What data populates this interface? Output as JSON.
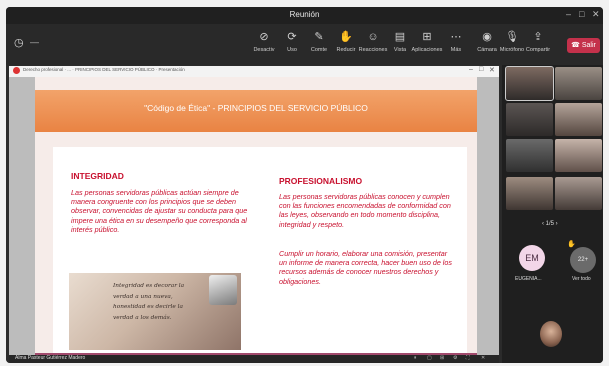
{
  "window": {
    "title": "Reunión",
    "minimize": "–",
    "maximize": "□",
    "close": "✕"
  },
  "toolbar": {
    "clock": "—",
    "tools": [
      {
        "icon": "⊘",
        "label": "Desactiv",
        "name": "camera-toggle"
      },
      {
        "icon": "⟳",
        "label": "Uso",
        "name": "mic-toggle"
      },
      {
        "icon": "✎",
        "label": "Comte",
        "name": "share-toggle"
      },
      {
        "icon": "✋",
        "label": "Reducir",
        "name": "raise-hand"
      },
      {
        "icon": "☺",
        "label": "Reacciones",
        "name": "reactions"
      },
      {
        "icon": "▤",
        "label": "Vista",
        "name": "view"
      },
      {
        "icon": "⊞",
        "label": "Aplicaciones",
        "name": "apps"
      },
      {
        "icon": "⋯",
        "label": "Más",
        "name": "more"
      },
      {
        "icon": "◉",
        "label": "Cámara",
        "name": "camera"
      },
      {
        "icon": "🎙",
        "label": "Micrófono",
        "name": "microphone"
      },
      {
        "icon": "⇪",
        "label": "Compartir",
        "name": "share"
      }
    ],
    "leave_label": "Salir"
  },
  "browser": {
    "url": "Derecho profesional · ... · PRINCIPIOS DEL SERVICIO PÚBLICO · Presentación",
    "min": "–",
    "max": "□",
    "close": "✕"
  },
  "slide": {
    "title": "\"Código de Ética\" - PRINCIPIOS DEL SERVICIO PÚBLICO",
    "left_heading": "INTEGRIDAD",
    "left_text": "Las personas servidoras públicas actúan siempre de manera congruente con los principios que se deben observar, convencidas de ajustar su conducta para que impere una ética en su desempeño que corresponda al interés público.",
    "right_heading": "PROFESIONALISMO",
    "right_text_1": "Las personas servidoras públicas conocen y cumplen con las funciones encomendadas de conformidad con las leyes, observando en todo momento disciplina, integridad y respeto.",
    "right_text_2": "Cumplir un horario, elaborar una comisión, presentar un informe de manera correcta, hacer buen uso de los recursos además de conocer nuestros derechos y obligaciones.",
    "image_quote": "Integridad es decorar la verdad a una nueva, honestidad es decirle la verdad a los demás."
  },
  "taskbar": {
    "presenter": "Alma Pasteur Gutiérrez Madero",
    "icons": [
      "⏸",
      "▢",
      "⊞",
      "⚙",
      "⛶",
      "✕"
    ]
  },
  "participants": {
    "pager": "‹  1/5  ›",
    "avatar_initials": "EM",
    "avatar_name": "EUGENIA...",
    "extra_count": "22+",
    "extra_label": "Ver todo",
    "hand_icon": "✋"
  }
}
